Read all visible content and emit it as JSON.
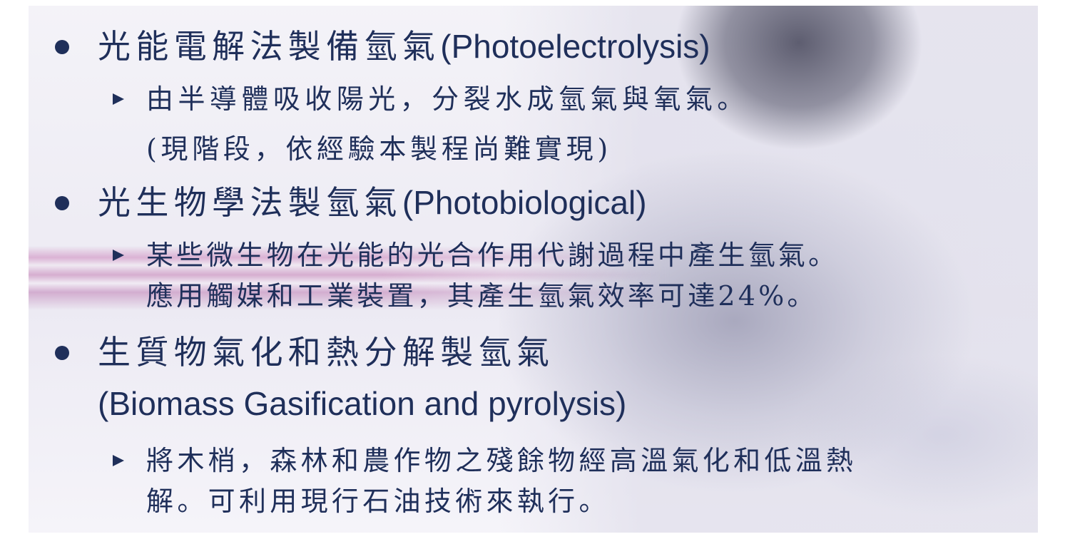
{
  "sections": [
    {
      "heading_zh": "光能電解法製備氫氣",
      "heading_en": "(Photoelectrolysis)",
      "sub_line1": "由半導體吸收陽光，分裂水成氫氣與氧氣。",
      "sub_line2": "(現階段，依經驗本製程尚難實現)"
    },
    {
      "heading_zh": "光生物學法製氫氣",
      "heading_en": "(Photobiological)",
      "sub_line1": "某些微生物在光能的光合作用代謝過程中產生氫氣。",
      "sub_line2": "應用觸媒和工業裝置，其產生氫氣效率可達24%。"
    },
    {
      "heading_zh": "生質物氣化和熱分解製氫氣",
      "heading_en": "(Biomass Gasification and pyrolysis)",
      "sub_line1": "將木梢，森林和農作物之殘餘物經高溫氣化和低溫熱",
      "sub_line2": "解。可利用現行石油技術來執行。"
    }
  ],
  "colors": {
    "text": "#1f2f5a",
    "streak": "#c070b0"
  },
  "icons": {
    "bullet": "filled-circle",
    "sub_bullet": "right-triangle-arrow"
  }
}
